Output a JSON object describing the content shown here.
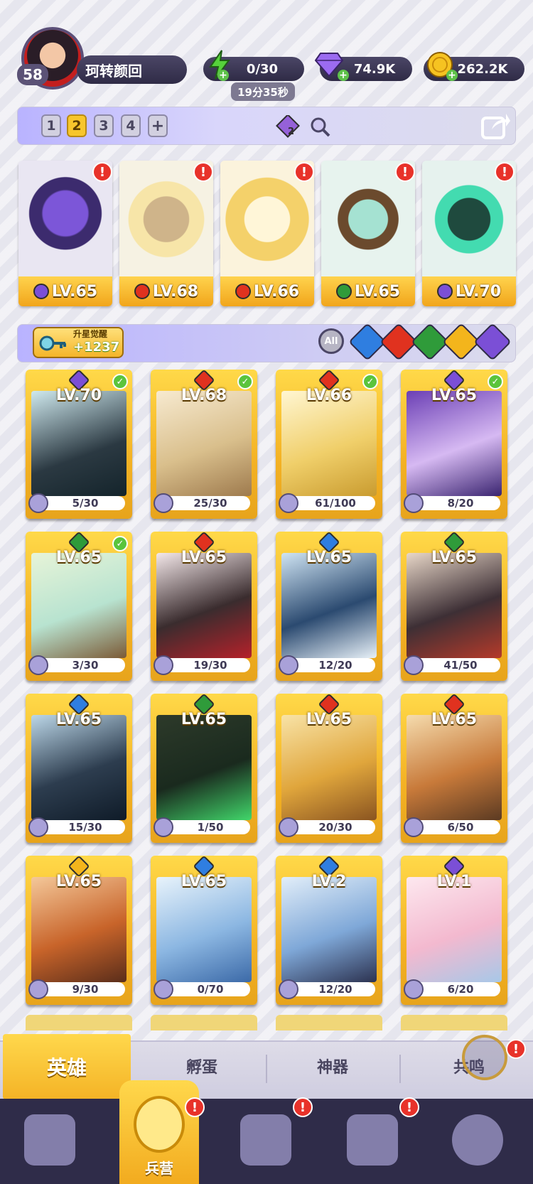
{
  "player": {
    "level": "58",
    "name": "珂转颜回"
  },
  "resources": {
    "energy": "0/30",
    "energy_timer": "19分35秒",
    "gems": "74.9K",
    "gold": "262.2K"
  },
  "team": {
    "tabs": [
      "1",
      "2",
      "3",
      "4",
      "+"
    ],
    "active_tab": "2",
    "badge_count": "2"
  },
  "team_heroes": [
    {
      "level": "LV.65",
      "element": "purple"
    },
    {
      "level": "LV.68",
      "element": "red"
    },
    {
      "level": "LV.66",
      "element": "red"
    },
    {
      "level": "LV.65",
      "element": "green"
    },
    {
      "level": "LV.70",
      "element": "purple"
    }
  ],
  "filter": {
    "star_label": "升星觉醒",
    "star_value": "+1237",
    "all_label": "All"
  },
  "heroes": [
    {
      "level": "LV.70",
      "progress": "5/30",
      "element": "purple",
      "checked": true
    },
    {
      "level": "LV.68",
      "progress": "25/30",
      "element": "red",
      "checked": true
    },
    {
      "level": "LV.66",
      "progress": "61/100",
      "element": "red",
      "checked": true
    },
    {
      "level": "LV.65",
      "progress": "8/20",
      "element": "purple",
      "checked": true
    },
    {
      "level": "LV.65",
      "progress": "3/30",
      "element": "green",
      "checked": true
    },
    {
      "level": "LV.65",
      "progress": "19/30",
      "element": "red",
      "checked": false
    },
    {
      "level": "LV.65",
      "progress": "12/20",
      "element": "blue",
      "checked": false
    },
    {
      "level": "LV.65",
      "progress": "41/50",
      "element": "green",
      "checked": false
    },
    {
      "level": "LV.65",
      "progress": "15/30",
      "element": "blue",
      "checked": false
    },
    {
      "level": "LV.65",
      "progress": "1/50",
      "element": "green",
      "checked": false
    },
    {
      "level": "LV.65",
      "progress": "20/30",
      "element": "red",
      "checked": false
    },
    {
      "level": "LV.65",
      "progress": "6/50",
      "element": "red",
      "checked": false
    },
    {
      "level": "LV.65",
      "progress": "9/30",
      "element": "gold",
      "checked": false
    },
    {
      "level": "LV.65",
      "progress": "0/70",
      "element": "blue",
      "checked": false
    },
    {
      "level": "LV.2",
      "progress": "12/20",
      "element": "blue",
      "checked": false
    },
    {
      "level": "LV.1",
      "progress": "6/20",
      "element": "purple",
      "checked": false
    }
  ],
  "subtabs": [
    "英雄",
    "孵蛋",
    "神器",
    "共鸣"
  ],
  "nav": {
    "active_label": "兵营"
  },
  "colors": {
    "purple": "#7b4fd6",
    "red": "#e0321f",
    "green": "#2f9b3a",
    "blue": "#2f7ee0",
    "gold": "#f3b51c",
    "accent": "#f7c62c"
  }
}
